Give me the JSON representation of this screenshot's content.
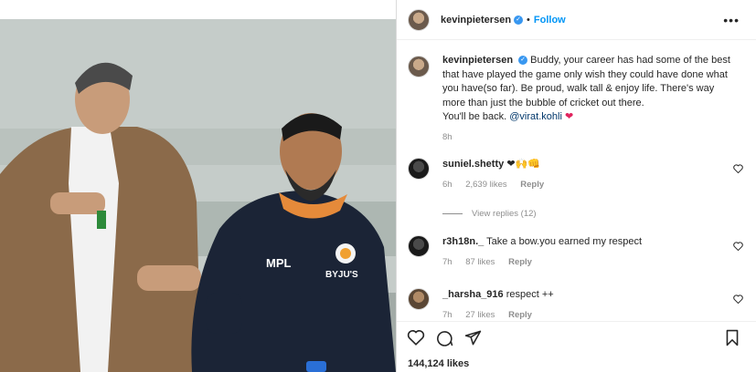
{
  "post": {
    "author": "kevinpietersen",
    "follow_label": "Follow",
    "more_label": "•••",
    "caption_prefix": "Buddy, your career has had some of the best that have played the game only wish they could have done what you have(so far). Be proud, walk tall & enjoy life. There's way more than just the bubble of cricket out there.",
    "caption_line2": "You'll be back.",
    "caption_mention": "@virat.kohli",
    "caption_emoji": "❤",
    "time_ago": "8h",
    "likes": "144,124 likes"
  },
  "photo": {
    "jersey_logo": "MPL",
    "jersey_sponsor": "BYJU'S"
  },
  "comments": [
    {
      "user": "suniel.shetty",
      "text": "❤🙌👊",
      "time": "6h",
      "likes": "2,639 likes",
      "reply_label": "Reply"
    },
    {
      "user": "r3h18n._",
      "text": "Take a bow.you earned my respect",
      "time": "7h",
      "likes": "87 likes",
      "reply_label": "Reply"
    },
    {
      "user": "_harsha_916",
      "text": "respect ++",
      "time": "7h",
      "likes": "27 likes",
      "reply_label": "Reply"
    }
  ],
  "view_replies": "View replies (12)",
  "icons": [
    "heart-icon",
    "comment-icon",
    "share-icon",
    "bookmark-icon",
    "verified-icon",
    "more-options-icon"
  ],
  "colors": {
    "accent": "#0095f6",
    "mention": "#00376b",
    "heart": "#e0245e",
    "verified": "#3897f0"
  }
}
